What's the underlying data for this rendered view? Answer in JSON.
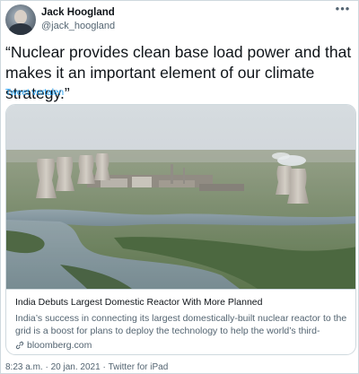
{
  "author": {
    "display_name": "Jack Hoogland",
    "handle": "@jack_hoogland"
  },
  "more_icon": "more-horizontal-icon",
  "tweet": {
    "text": "“Nuclear provides clean base load power and that makes it an important element of our climate strategy.”",
    "translate_label": "Tweet vertalen"
  },
  "card": {
    "image_description": "aerial-photo-nuclear-power-plant-cooling-towers-river",
    "title": "India Debuts Largest Domestic Reactor With More Planned",
    "description": "India’s success in connecting its largest domestically-built nuclear reactor to the grid is a boost for plans to deploy the technology to help the world’s third-bigge…",
    "domain": "bloomberg.com",
    "domain_icon": "link-icon"
  },
  "meta": {
    "time": "8:23 a.m.",
    "separator": "·",
    "date": "20 jan. 2021",
    "source": "Twitter for iPad"
  },
  "colors": {
    "text_primary": "#0f1419",
    "text_secondary": "#536471",
    "link": "#1d9bf0",
    "border": "#cfd9de"
  }
}
